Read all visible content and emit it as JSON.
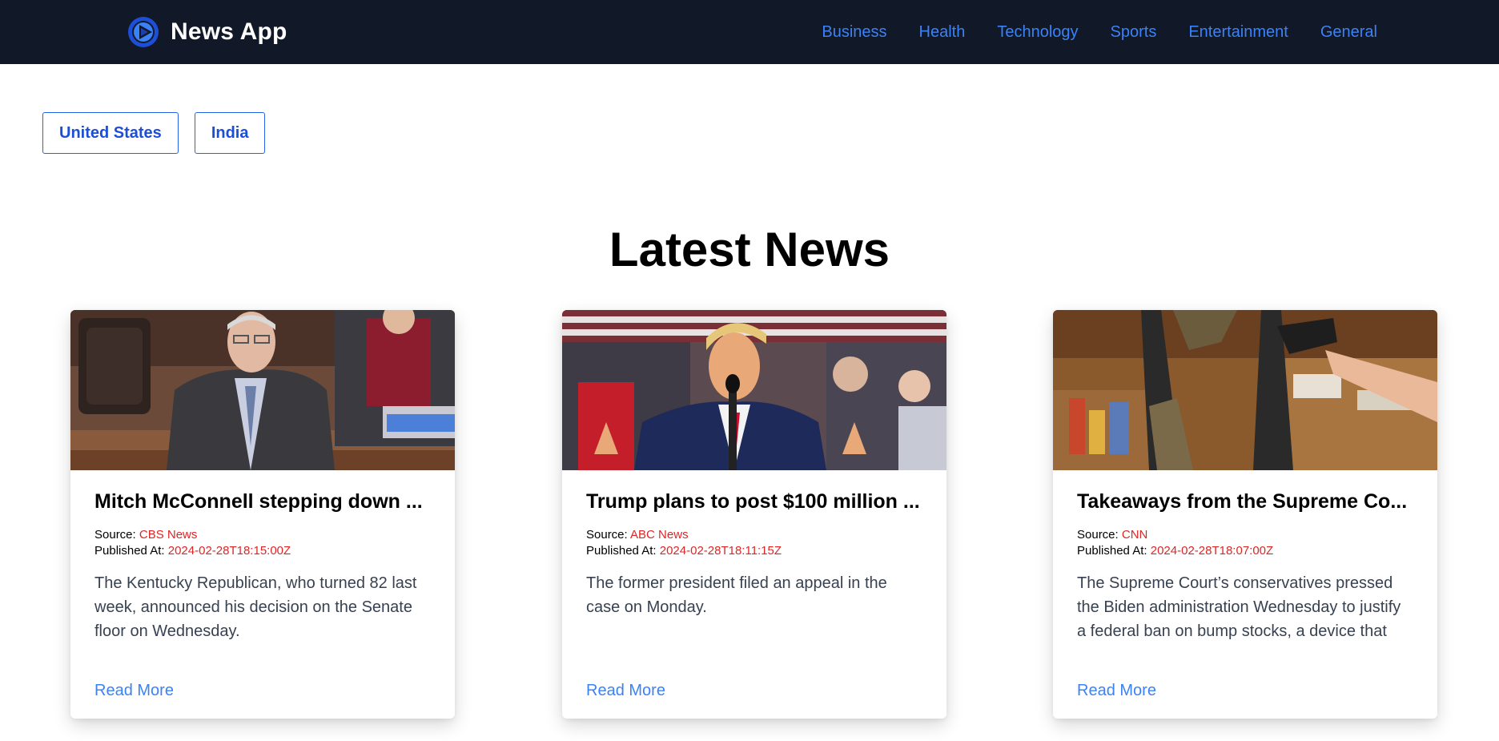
{
  "brand": {
    "name": "News App",
    "logo_icon": "play-circle-icon",
    "accent": "#3b82f6"
  },
  "nav": [
    {
      "label": "Business"
    },
    {
      "label": "Health"
    },
    {
      "label": "Technology"
    },
    {
      "label": "Sports"
    },
    {
      "label": "Entertainment"
    },
    {
      "label": "General"
    }
  ],
  "countries": [
    {
      "label": "United States"
    },
    {
      "label": "India"
    }
  ],
  "main": {
    "title": "Latest News"
  },
  "labels": {
    "source": "Source:",
    "published": "Published At:",
    "read_more": "Read More"
  },
  "articles": [
    {
      "title": "Mitch McConnell stepping down ...",
      "source": "CBS News",
      "published_at": "2024-02-28T18:15:00Z",
      "description": "The Kentucky Republican, who turned 82 last week, announced his decision on the Senate floor on Wednesday.",
      "image": "senate-floor-speaker-photo"
    },
    {
      "title": "Trump plans to post $100 million ...",
      "source": "ABC News",
      "published_at": "2024-02-28T18:11:15Z",
      "description": "The former president filed an appeal in the case on Monday.",
      "image": "rally-speaker-at-podium-photo"
    },
    {
      "title": "Takeaways from the Supreme Co...",
      "source": "CNN",
      "published_at": "2024-02-28T18:07:00Z",
      "description": "The Supreme Court’s conservatives pressed the Biden administration Wednesday to justify a federal ban on bump stocks, a device that can",
      "image": "gun-store-rifles-photo"
    }
  ],
  "colors": {
    "navbar_bg": "#111827",
    "link": "#3b82f6",
    "meta_value": "#dc2626",
    "button_border": "#2563eb"
  }
}
